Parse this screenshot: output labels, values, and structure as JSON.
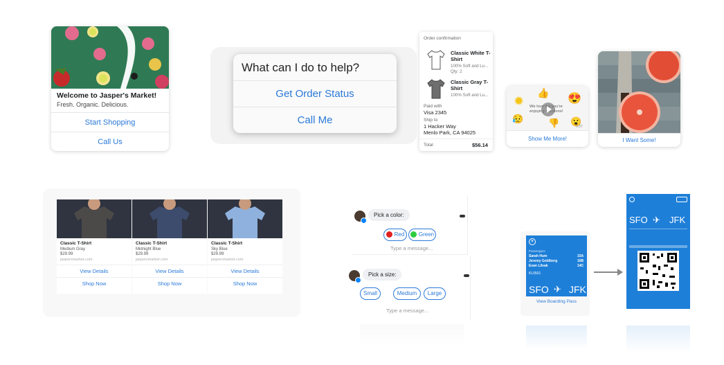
{
  "welcome_card": {
    "title": "Welcome to Jasper's Market!",
    "subtitle": "Fresh. Organic. Delicious.",
    "buttons": [
      "Start Shopping",
      "Call Us"
    ]
  },
  "quick_help": {
    "question": "What can I do to help?",
    "buttons": [
      "Get Order Status",
      "Call Me"
    ]
  },
  "receipt": {
    "header": "Order confirmation",
    "items": [
      {
        "name": "Classic White T-Shirt",
        "desc": "100% Soft and Lu...",
        "qty": "Qty: 2"
      },
      {
        "name": "Classic Gray T-Shirt",
        "desc": "100% Soft and Lu..."
      }
    ],
    "paid_with_label": "Paid with",
    "paid_with": "Visa 2345",
    "ship_to_label": "Ship to",
    "address": [
      "1 Hacker Way",
      "Menlo Park, CA 94025"
    ],
    "total_label": "Total",
    "total": "$56.14"
  },
  "reactions_card": {
    "overlay": "We love the you're enjoying reactions!",
    "time": "0:37",
    "button": "Show Me More!"
  },
  "grapefruit_card": {
    "button": "I Want Some!"
  },
  "carousel": {
    "items": [
      {
        "name": "Classic T-Shirt",
        "color": "Medium Gray",
        "price": "$29.99",
        "domain": "jaspersmarket.com",
        "shirt": "#4b4a48",
        "bg": "#2f3440",
        "view": "View Details",
        "shop": "Shop Now"
      },
      {
        "name": "Classic T-Shirt",
        "color": "Midnight Blue",
        "price": "$29.99",
        "domain": "jaspersmarket.com",
        "shirt": "#3a4a6a",
        "bg": "#2f3440",
        "view": "View Details",
        "shop": "Shop Now"
      },
      {
        "name": "Classic T-Shirt",
        "color": "Sky Blue",
        "price": "$29.99",
        "domain": "jaspersmarket.com",
        "shirt": "#8fb1dd",
        "bg": "#2f3440",
        "view": "View Details",
        "shop": "Shop Now"
      }
    ]
  },
  "chat_color": {
    "prompt": "Pick a color:",
    "options": [
      {
        "label": "Red",
        "color": "#e02020"
      },
      {
        "label": "Green",
        "color": "#2ecc40"
      }
    ],
    "placeholder": "Type a message..."
  },
  "chat_size": {
    "prompt": "Pick a size:",
    "options": [
      "Small",
      "Medium",
      "Large"
    ],
    "placeholder": "Type a message..."
  },
  "boarding": {
    "passengers_label": "Passengers",
    "passengers": [
      "Sarah Hum",
      "Jeremy Goldberg",
      "Evan Lilvak"
    ],
    "seats": [
      "15A",
      "16B",
      "14C"
    ],
    "from": "SFO",
    "to": "JFK",
    "flight": "KL0501",
    "button": "View Boarding Pass"
  }
}
